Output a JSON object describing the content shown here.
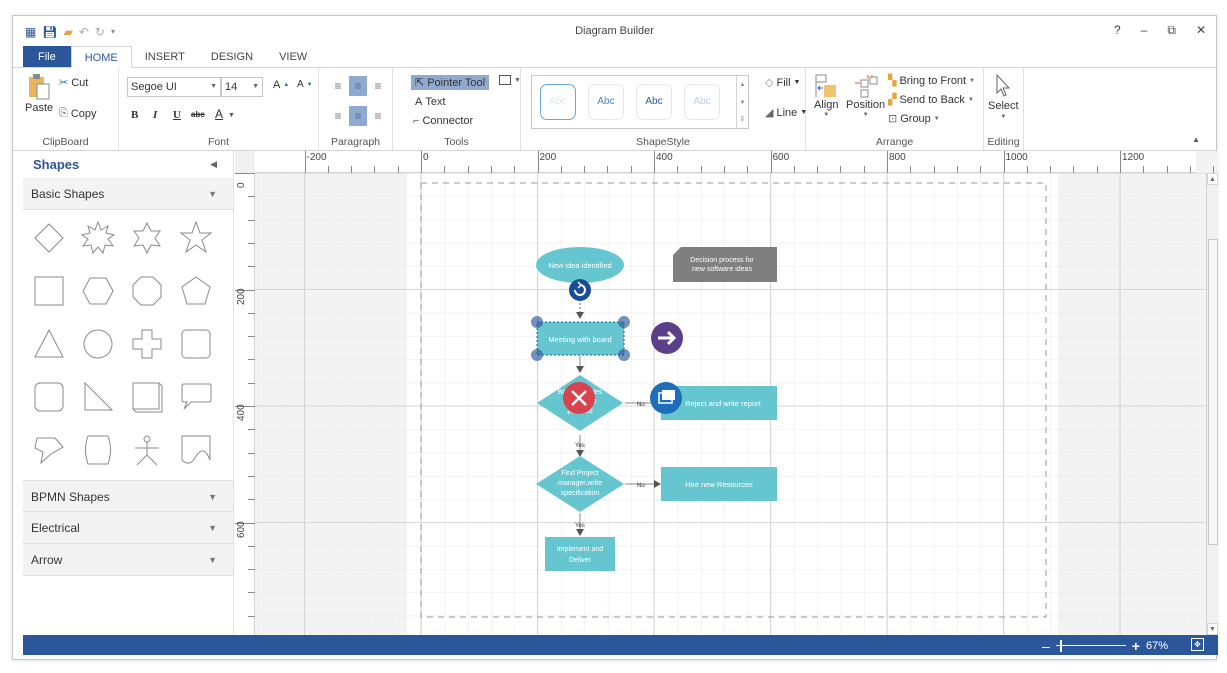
{
  "window": {
    "title": "Diagram Builder",
    "controls": {
      "help": "?",
      "minimize": "–",
      "restore": "⧉",
      "close": "✕"
    }
  },
  "quick_access": [
    "app-menu",
    "save",
    "open",
    "undo",
    "redo",
    "customize"
  ],
  "tabs": [
    {
      "label": "File",
      "active": false
    },
    {
      "label": "HOME",
      "active": true
    },
    {
      "label": "INSERT",
      "active": false
    },
    {
      "label": "DESIGN",
      "active": false
    },
    {
      "label": "VIEW",
      "active": false
    }
  ],
  "ribbon": {
    "clipboard": {
      "label": "ClipBoard",
      "paste": "Paste",
      "cut": "Cut",
      "copy": "Copy"
    },
    "font": {
      "label": "Font",
      "family": "Segoe UI",
      "size": "14",
      "grow": "A",
      "shrink": "A",
      "bold": "B",
      "italic": "I",
      "underline": "U",
      "strike": "abc",
      "color": "A",
      "color_value": "#000000"
    },
    "paragraph": {
      "label": "Paragraph"
    },
    "tools": {
      "label": "Tools",
      "pointer": "Pointer Tool",
      "text": "Text",
      "connector": "Connector"
    },
    "shape_style": {
      "label": "ShapeStyle",
      "items": [
        "Abc",
        "Abc",
        "Abc",
        "Abc"
      ],
      "fill": "Fill",
      "line": "Line"
    },
    "arrange": {
      "label": "Arrange",
      "align": "Align",
      "position": "Position",
      "bring_front": "Bring to Front",
      "send_back": "Send to Back",
      "group": "Group"
    },
    "editing": {
      "label": "Editing",
      "select": "Select"
    }
  },
  "shapes_panel": {
    "title": "Shapes",
    "sections": [
      {
        "label": "Basic Shapes",
        "expanded": true
      },
      {
        "label": "BPMN Shapes",
        "expanded": false
      },
      {
        "label": "Electrical",
        "expanded": false
      },
      {
        "label": "Arrow",
        "expanded": false
      }
    ],
    "basic_shapes": [
      "diamond",
      "burst",
      "six-point-star",
      "five-point-star",
      "square",
      "hexagon",
      "octagon",
      "pentagon",
      "triangle",
      "circle",
      "cross",
      "rounded-square",
      "rounded-rectangle",
      "right-triangle",
      "cube",
      "speech-bubble",
      "callout",
      "barrel",
      "actor",
      "wave-document"
    ]
  },
  "rulers": {
    "horizontal": [
      "-200",
      "0",
      "200",
      "400",
      "600",
      "800",
      "1000",
      "1200"
    ],
    "vertical": [
      "0",
      "200",
      "400",
      "600"
    ]
  },
  "diagram": {
    "colors": {
      "node": "#66c6d0",
      "annotation": "#7f7f7f",
      "handle": "#2b579a",
      "rotate": "#1a4c9c",
      "next": "#5b3f8a",
      "delete": "#d9434f",
      "copy": "#1c6fb8"
    },
    "nodes": [
      {
        "id": "start",
        "shape": "ellipse",
        "text": "New idea identified"
      },
      {
        "id": "note",
        "shape": "annotation",
        "text_lines": [
          "Decision process for",
          "new software ideas"
        ]
      },
      {
        "id": "meeting",
        "shape": "rectangle",
        "text": "Meeting with board",
        "selected": true
      },
      {
        "id": "decision1",
        "shape": "diamond",
        "text_lines": [
          "Board decides",
          "whether to",
          "proceed"
        ]
      },
      {
        "id": "reject",
        "shape": "rectangle",
        "text": "Reject and write report"
      },
      {
        "id": "decision2",
        "shape": "diamond",
        "text_lines": [
          "Find Project",
          "manager,write",
          "specification"
        ]
      },
      {
        "id": "hire",
        "shape": "rectangle",
        "text": "Hire new Resources"
      },
      {
        "id": "implement",
        "shape": "rectangle",
        "text_lines": [
          "Implement and",
          "Deliver"
        ]
      }
    ],
    "connector_labels": {
      "no1": "No",
      "yes1": "Yes",
      "no2": "No",
      "yes2": "Yes"
    }
  },
  "status": {
    "zoom_minus": "–",
    "zoom_plus": "+",
    "zoom_percent": "67%",
    "zoom_level": 0.67
  }
}
